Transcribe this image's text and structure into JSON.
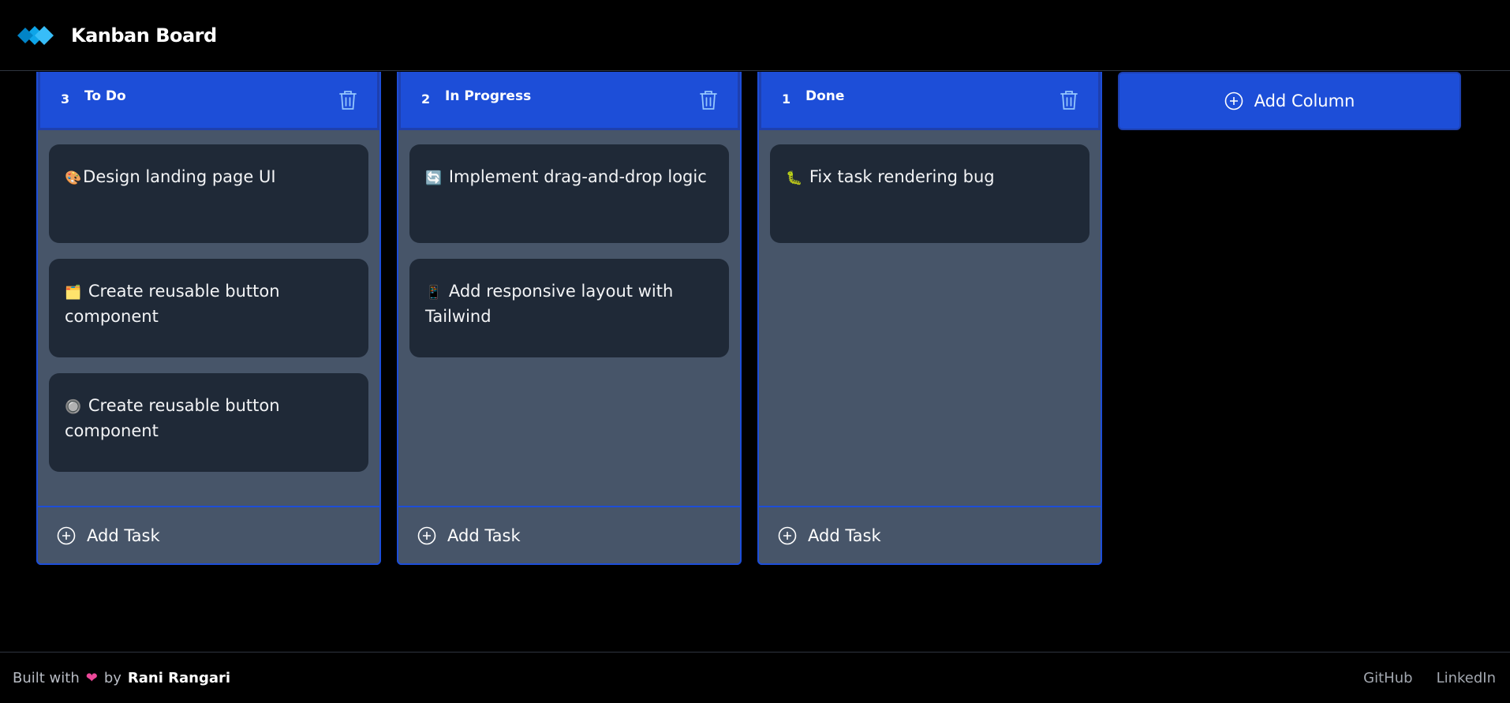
{
  "header": {
    "title": "Kanban Board",
    "logo_icon": "diamond-logo-icon"
  },
  "columns": [
    {
      "count": "3",
      "title": "To Do",
      "tasks": [
        {
          "emoji": "🎨",
          "text": "Design landing page UI"
        },
        {
          "emoji": "🗂️",
          "text": "Create reusable button component"
        },
        {
          "emoji": "🔘",
          "text": "Create reusable button component"
        }
      ],
      "add_label": "Add Task"
    },
    {
      "count": "2",
      "title": "In Progress",
      "tasks": [
        {
          "emoji": "🔄",
          "text": "Implement drag-and-drop logic"
        },
        {
          "emoji": "📱",
          "text": "Add responsive layout with Tailwind"
        }
      ],
      "add_label": "Add Task"
    },
    {
      "count": "1",
      "title": "Done",
      "tasks": [
        {
          "emoji": "🐛",
          "text": "Fix task rendering bug"
        }
      ],
      "add_label": "Add Task"
    }
  ],
  "add_column_label": "Add Column",
  "footer": {
    "built_with": "Built with",
    "heart": "❤",
    "by": "by",
    "author": "Rani Rangari",
    "links": [
      "GitHub",
      "LinkedIn"
    ]
  },
  "colors": {
    "accent": "#1d4ed8",
    "column_bg": "#475569",
    "card_bg": "#1f2937",
    "background": "#000000"
  }
}
